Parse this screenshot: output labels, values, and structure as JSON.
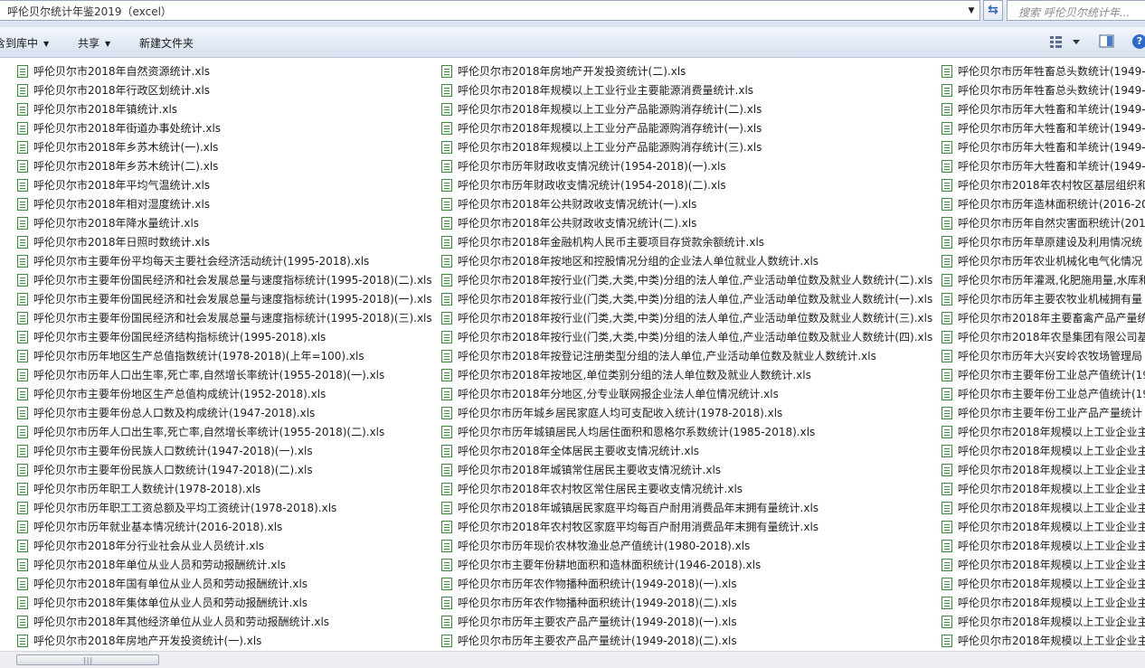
{
  "address": {
    "path": "呼伦贝尔统计年鉴2019（excel）",
    "dropdown_icon": "chevron-down-icon",
    "refresh_icon": "refresh-icon"
  },
  "search": {
    "placeholder": "搜索 呼伦贝尔统计年..."
  },
  "toolbar": {
    "include_library": "含到库中",
    "share": "共享",
    "new_folder": "新建文件夹",
    "view_icon": "view-options-icon",
    "preview_icon": "preview-pane-icon",
    "help": "?"
  },
  "files": {
    "col1": [
      "呼伦贝尔市2018年自然资源统计.xls",
      "呼伦贝尔市2018年行政区划统计.xls",
      "呼伦贝尔市2018年镇统计.xls",
      "呼伦贝尔市2018年街道办事处统计.xls",
      "呼伦贝尔市2018年乡苏木统计(一).xls",
      "呼伦贝尔市2018年乡苏木统计(二).xls",
      "呼伦贝尔市2018年平均气温统计.xls",
      "呼伦贝尔市2018年相对湿度统计.xls",
      "呼伦贝尔市2018年降水量统计.xls",
      "呼伦贝尔市2018年日照时数统计.xls",
      "呼伦贝尔市主要年份平均每天主要社会经济活动统计(1995-2018).xls",
      "呼伦贝尔市主要年份国民经济和社会发展总量与速度指标统计(1995-2018)(二).xls",
      "呼伦贝尔市主要年份国民经济和社会发展总量与速度指标统计(1995-2018)(一).xls",
      "呼伦贝尔市主要年份国民经济和社会发展总量与速度指标统计(1995-2018)(三).xls",
      "呼伦贝尔市主要年份国民经济结构指标统计(1995-2018).xls",
      "呼伦贝尔市历年地区生产总值指数统计(1978-2018)(上年=100).xls",
      "呼伦贝尔市历年人口出生率,死亡率,自然增长率统计(1955-2018)(一).xls",
      "呼伦贝尔市主要年份地区生产总值构成统计(1952-2018).xls",
      "呼伦贝尔市主要年份总人口数及构成统计(1947-2018).xls",
      "呼伦贝尔市历年人口出生率,死亡率,自然增长率统计(1955-2018)(二).xls",
      "呼伦贝尔市主要年份民族人口数统计(1947-2018)(一).xls",
      "呼伦贝尔市主要年份民族人口数统计(1947-2018)(二).xls",
      "呼伦贝尔市历年职工人数统计(1978-2018).xls",
      "呼伦贝尔市历年职工工资总额及平均工资统计(1978-2018).xls",
      "呼伦贝尔市历年就业基本情况统计(2016-2018).xls",
      "呼伦贝尔市2018年分行业社会从业人员统计.xls",
      "呼伦贝尔市2018年单位从业人员和劳动报酬统计.xls",
      "呼伦贝尔市2018年国有单位从业人员和劳动报酬统计.xls",
      "呼伦贝尔市2018年集体单位从业人员和劳动报酬统计.xls",
      "呼伦贝尔市2018年其他经济单位从业人员和劳动报酬统计.xls",
      "呼伦贝尔市2018年房地产开发投资统计(一).xls"
    ],
    "col2": [
      "呼伦贝尔市2018年房地产开发投资统计(二).xls",
      "呼伦贝尔市2018年规模以上工业行业主要能源消费量统计.xls",
      "呼伦贝尔市2018年规模以上工业分产品能源购消存统计(二).xls",
      "呼伦贝尔市2018年规模以上工业分产品能源购消存统计(一).xls",
      "呼伦贝尔市2018年规模以上工业分产品能源购消存统计(三).xls",
      "呼伦贝尔市历年财政收支情况统计(1954-2018)(一).xls",
      "呼伦贝尔市历年财政收支情况统计(1954-2018)(二).xls",
      "呼伦贝尔市2018年公共财政收支情况统计(一).xls",
      "呼伦贝尔市2018年公共财政收支情况统计(二).xls",
      "呼伦贝尔市2018年金融机构人民币主要项目存贷款余额统计.xls",
      "呼伦贝尔市2018年按地区和控股情况分组的企业法人单位就业人数统计.xls",
      "呼伦贝尔市2018年按行业(门类,大类,中类)分组的法人单位,产业活动单位数及就业人数统计(二).xls",
      "呼伦贝尔市2018年按行业(门类,大类,中类)分组的法人单位,产业活动单位数及就业人数统计(一).xls",
      "呼伦贝尔市2018年按行业(门类,大类,中类)分组的法人单位,产业活动单位数及就业人数统计(三).xls",
      "呼伦贝尔市2018年按行业(门类,大类,中类)分组的法人单位,产业活动单位数及就业人数统计(四).xls",
      "呼伦贝尔市2018年按登记注册类型分组的法人单位,产业活动单位数及就业人数统计.xls",
      "呼伦贝尔市2018年按地区,单位类别分组的法人单位数及就业人数统计.xls",
      "呼伦贝尔市2018年分地区,分专业联网报企业法人单位情况统计.xls",
      "呼伦贝尔市历年城乡居民家庭人均可支配收入统计(1978-2018).xls",
      "呼伦贝尔市历年城镇居民人均居住面积和恩格尔系数统计(1985-2018).xls",
      "呼伦贝尔市2018年全体居民主要收支情况统计.xls",
      "呼伦贝尔市2018年城镇常住居民主要收支情况统计.xls",
      "呼伦贝尔市2018年农村牧区常住居民主要收支情况统计.xls",
      "呼伦贝尔市2018年城镇居民家庭平均每百户耐用消费品年末拥有量统计.xls",
      "呼伦贝尔市2018年农村牧区家庭平均每百户耐用消费品年末拥有量统计.xls",
      "呼伦贝尔市历年现价农林牧渔业总产值统计(1980-2018).xls",
      "呼伦贝尔市主要年份耕地面积和造林面积统计(1946-2018).xls",
      "呼伦贝尔市历年农作物播种面积统计(1949-2018)(一).xls",
      "呼伦贝尔市历年农作物播种面积统计(1949-2018)(二).xls",
      "呼伦贝尔市历年主要农产品产量统计(1949-2018)(一).xls",
      "呼伦贝尔市历年主要农产品产量统计(1949-2018)(二).xls"
    ],
    "col3": [
      "呼伦贝尔市历年牲畜总头数统计(1949-2",
      "呼伦贝尔市历年牲畜总头数统计(1949-2",
      "呼伦贝尔市历年大牲畜和羊统计(1949-2",
      "呼伦贝尔市历年大牲畜和羊统计(1949-2",
      "呼伦贝尔市历年大牲畜和羊统计(1949-2",
      "呼伦贝尔市历年大牲畜和羊统计(1949-2",
      "呼伦贝尔市2018年农村牧区基层组织和",
      "呼伦贝尔市历年造林面积统计(2016-20",
      "呼伦贝尔市历年自然灾害面积统计(201",
      "呼伦贝尔市历年草原建设及利用情况统",
      "呼伦贝尔市历年农业机械化电气化情况",
      "呼伦贝尔市历年灌溉,化肥施用量,水库和",
      "呼伦贝尔市历年主要农牧业机械拥有量",
      "呼伦贝尔市2018年主要畜禽产品产量统",
      "呼伦贝尔市2018年农垦集团有限公司基",
      "呼伦贝尔市历年大兴安岭农牧场管理局",
      "呼伦贝尔市主要年份工业总产值统计(19",
      "呼伦贝尔市主要年份工业总产值统计(19",
      "呼伦贝尔市主要年份工业产品产量统计",
      "呼伦贝尔市2018年规模以上工业企业主",
      "呼伦贝尔市2018年规模以上工业企业主",
      "呼伦贝尔市2018年规模以上工业企业主",
      "呼伦贝尔市2018年规模以上工业企业主",
      "呼伦贝尔市2018年规模以上工业企业主",
      "呼伦贝尔市2018年规模以上工业企业主",
      "呼伦贝尔市2018年规模以上工业企业主",
      "呼伦贝尔市2018年规模以上工业企业主",
      "呼伦贝尔市2018年规模以上工业企业主",
      "呼伦贝尔市2018年规模以上工业企业主",
      "呼伦贝尔市2018年规模以上工业企业主",
      "呼伦贝尔市2018年规模以上工业企业主"
    ]
  },
  "scrollbar": {
    "grip": "|||"
  }
}
